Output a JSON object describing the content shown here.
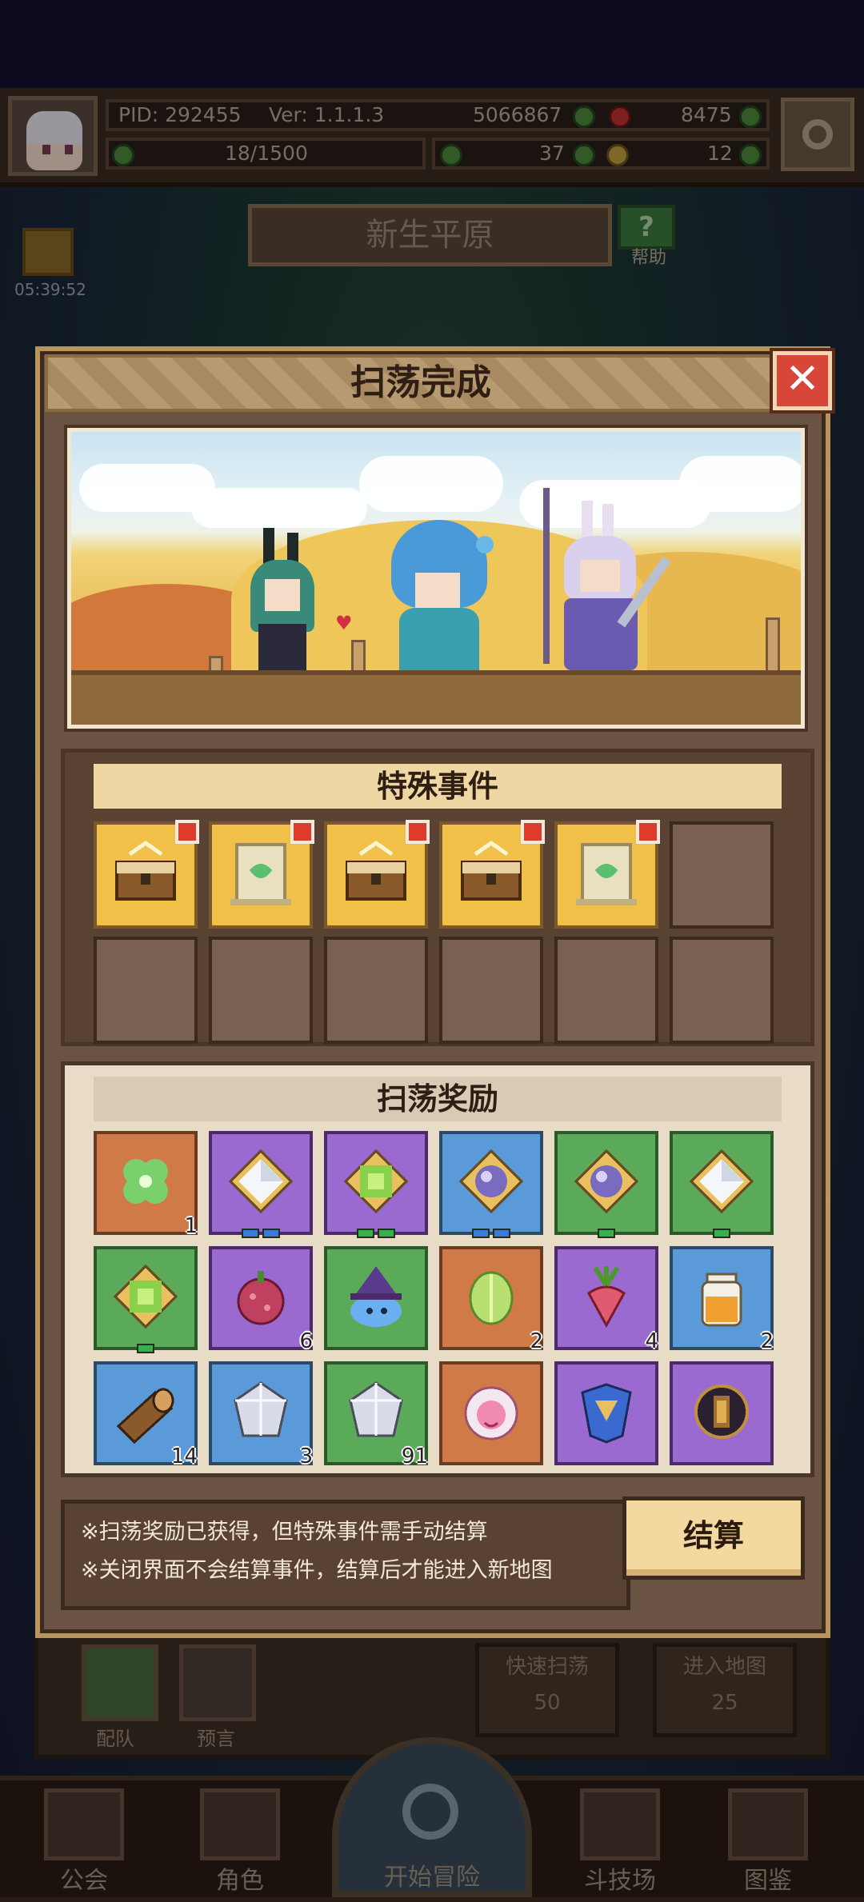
{
  "hud": {
    "pid": "PID: 292455",
    "version": "Ver: 1.1.1.3",
    "gold": "5066867",
    "gems": "8475",
    "stamina": "18/1500",
    "clover": "37",
    "key": "12"
  },
  "map": {
    "title": "新生平原",
    "help_label": "帮助"
  },
  "timer": "05:39:52",
  "lower_panel": {
    "team_label": "配队",
    "prophecy_label": "预言",
    "quick_sweep_label": "快速扫荡",
    "quick_sweep_cost": "50",
    "enter_map_label": "进入地图",
    "enter_map_cost": "25"
  },
  "bottom_nav": {
    "guild": "公会",
    "character": "角色",
    "adventure": "开始冒险",
    "arena": "斗技场",
    "codex": "图鉴"
  },
  "dialog": {
    "title": "扫荡完成",
    "close_icon": "close-icon",
    "events_title": "特殊事件",
    "rewards_title": "扫荡奖励",
    "note_1": "※扫荡奖励已获得，但特殊事件需手动结算",
    "note_2": "※关闭界面不会结算事件，结算后才能进入新地图",
    "settle_label": "结算"
  },
  "events": [
    {
      "icon": "treasure-chest-icon",
      "badge": true
    },
    {
      "icon": "green-portal-icon",
      "badge": true
    },
    {
      "icon": "treasure-chest-icon",
      "badge": true
    },
    {
      "icon": "treasure-chest-icon",
      "badge": true
    },
    {
      "icon": "green-portal-icon",
      "badge": true
    }
  ],
  "rewards": [
    {
      "icon": "clover-icon",
      "rarity": "orange",
      "count": "1"
    },
    {
      "icon": "white-gem-icon",
      "rarity": "purple",
      "count": ""
    },
    {
      "icon": "green-gem-icon",
      "rarity": "purple",
      "count": ""
    },
    {
      "icon": "purple-orb-gem-icon",
      "rarity": "blue",
      "count": ""
    },
    {
      "icon": "purple-orb-gem-icon",
      "rarity": "green",
      "count": ""
    },
    {
      "icon": "white-gem-icon",
      "rarity": "green",
      "count": ""
    },
    {
      "icon": "green-gem-icon",
      "rarity": "green",
      "count": ""
    },
    {
      "icon": "berry-icon",
      "rarity": "purple",
      "count": "6"
    },
    {
      "icon": "witch-slime-icon",
      "rarity": "green",
      "count": ""
    },
    {
      "icon": "cabbage-icon",
      "rarity": "orange",
      "count": "2"
    },
    {
      "icon": "radish-icon",
      "rarity": "purple",
      "count": "4"
    },
    {
      "icon": "honey-jar-icon",
      "rarity": "blue",
      "count": "2"
    },
    {
      "icon": "wood-log-icon",
      "rarity": "blue",
      "count": "14"
    },
    {
      "icon": "silver-crystal-icon",
      "rarity": "blue",
      "count": "3"
    },
    {
      "icon": "silver-crystal-icon",
      "rarity": "green",
      "count": "91"
    },
    {
      "icon": "pink-pet-icon",
      "rarity": "orange",
      "count": ""
    },
    {
      "icon": "blue-armor-icon",
      "rarity": "purple",
      "count": ""
    },
    {
      "icon": "dark-amulet-icon",
      "rarity": "purple",
      "count": ""
    }
  ],
  "colors": {
    "orange": "#d07a48",
    "purple": "#9a6ad0",
    "blue": "#5a9ad8",
    "green": "#5aaa5a",
    "badge_red": "#e03a2a"
  }
}
